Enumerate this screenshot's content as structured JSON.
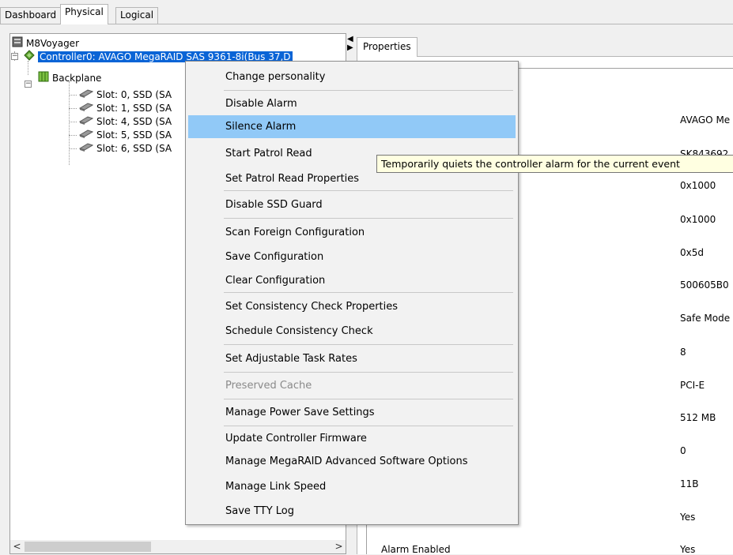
{
  "top_tabs": [
    {
      "label": "Dashboard",
      "active": false
    },
    {
      "label": "Physical",
      "active": true
    },
    {
      "label": "Logical",
      "active": false
    }
  ],
  "tree": {
    "root": "M8Voyager",
    "controller": "Controller0: AVAGO MegaRAID SAS 9361-8i(Bus 37,D",
    "backplane": "Backplane",
    "slots": [
      "Slot: 0, SSD  (SA",
      "Slot: 1, SSD  (SA",
      "Slot: 4, SSD  (SA",
      "Slot: 5, SSD  (SA",
      "Slot: 6, SSD  (SA"
    ]
  },
  "properties_tab": "Properties",
  "property_values": [
    "AVAGO Me",
    "SK843692",
    "0x1000",
    "0x1000",
    "0x5d",
    "500605B0",
    "Safe Mode",
    "8",
    "PCI-E",
    "512 MB",
    "0",
    "11B",
    "Yes",
    "Yes"
  ],
  "property_label_bottom": "Alarm Enabled",
  "context_menu": [
    {
      "label": "Change personality"
    },
    {
      "sep": true
    },
    {
      "label": "Disable Alarm"
    },
    {
      "label": "Silence Alarm",
      "highlighted": true
    },
    {
      "label": "Start Patrol Read"
    },
    {
      "label": "Set Patrol Read Properties"
    },
    {
      "sep": true
    },
    {
      "label": "Disable SSD Guard"
    },
    {
      "sep": true
    },
    {
      "label": "Scan Foreign Configuration"
    },
    {
      "label": "Save Configuration"
    },
    {
      "label": "Clear Configuration"
    },
    {
      "sep": true
    },
    {
      "label": "Set Consistency Check Properties"
    },
    {
      "label": "Schedule Consistency Check"
    },
    {
      "sep": true
    },
    {
      "label": "Set Adjustable Task Rates"
    },
    {
      "sep": true
    },
    {
      "label": "Preserved Cache",
      "disabled": true
    },
    {
      "sep": true
    },
    {
      "label": "Manage Power Save Settings"
    },
    {
      "sep": true
    },
    {
      "label": "Update Controller Firmware"
    },
    {
      "label": "Manage MegaRAID Advanced Software Options"
    },
    {
      "label": "Manage Link Speed"
    },
    {
      "label": "Save TTY Log"
    }
  ],
  "tooltip": "Temporarily quiets the controller alarm for the current event",
  "colors": {
    "selection": "#0a64d6",
    "menu_highlight": "#91c9f7",
    "tooltip_bg": "#ffffe1"
  },
  "icons": {
    "left_arrow": "◀",
    "right_arrow": "▶",
    "scroll_left": "<",
    "scroll_right": ">"
  }
}
